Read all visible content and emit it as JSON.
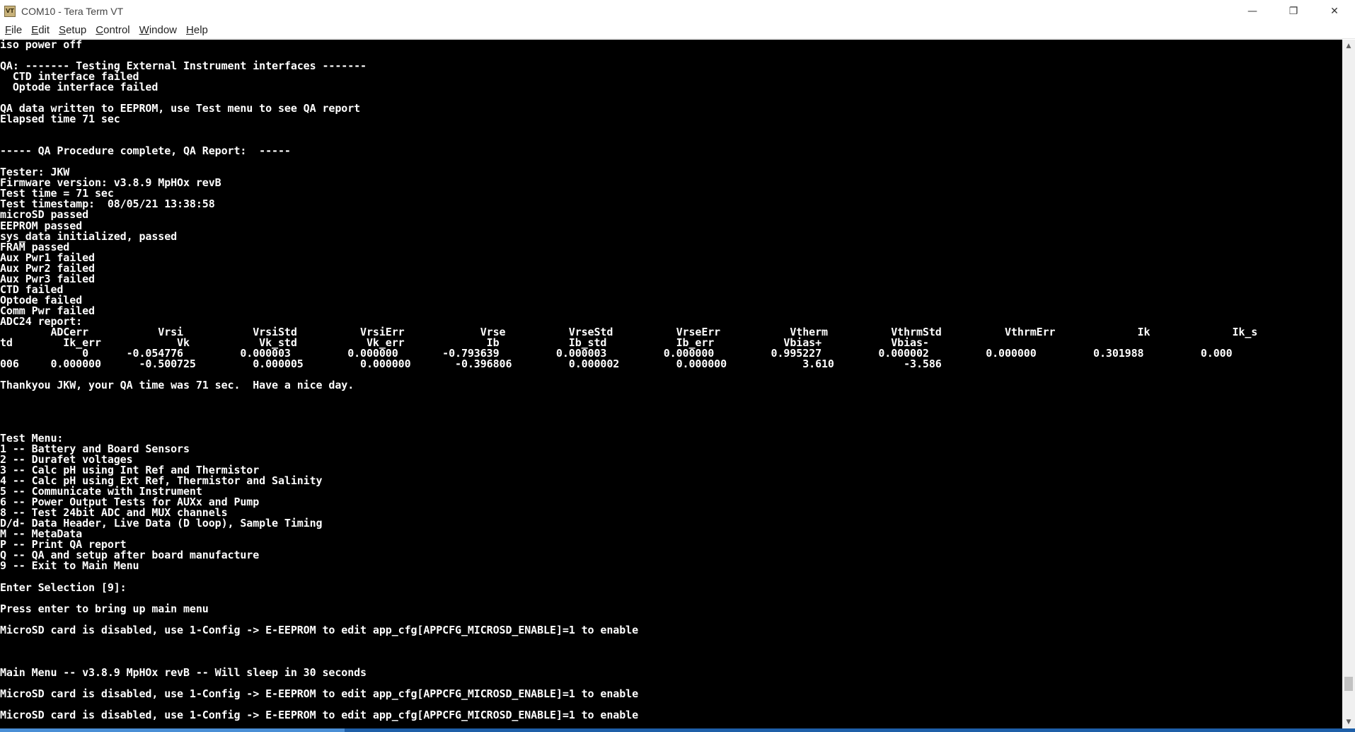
{
  "window": {
    "title": "COM10 - Tera Term VT",
    "icon_label": "VT",
    "controls": {
      "minimize": "—",
      "maximize": "❐",
      "close": "✕"
    }
  },
  "menu": [
    {
      "first": "F",
      "rest": "ile"
    },
    {
      "first": "E",
      "rest": "dit"
    },
    {
      "first": "S",
      "rest": "etup"
    },
    {
      "first": "C",
      "rest": "ontrol"
    },
    {
      "first": "W",
      "rest": "indow"
    },
    {
      "first": "H",
      "rest": "elp"
    }
  ],
  "terminal": {
    "lines": [
      {
        "row": 0,
        "text": "iso power off"
      },
      {
        "row": 2,
        "text": "QA: ------- Testing External Instrument interfaces -------"
      },
      {
        "row": 3,
        "text": "  CTD interface failed"
      },
      {
        "row": 4,
        "text": "  Optode interface failed"
      },
      {
        "row": 6,
        "text": "QA data written to EEPROM, use Test menu to see QA report"
      },
      {
        "row": 7,
        "text": "Elapsed time 71 sec"
      },
      {
        "row": 10,
        "text": "----- QA Procedure complete, QA Report:  -----"
      },
      {
        "row": 12,
        "text": "Tester: JKW"
      },
      {
        "row": 13,
        "text": "Firmware version: v3.8.9 MpHOx revB"
      },
      {
        "row": 14,
        "text": "Test time = 71 sec"
      },
      {
        "row": 15,
        "text": "Test timestamp:  08/05/21 13:38:58"
      },
      {
        "row": 16,
        "text": "microSD passed"
      },
      {
        "row": 17,
        "text": "EEPROM passed"
      },
      {
        "row": 18,
        "text": "sys_data initialized, passed"
      },
      {
        "row": 19,
        "text": "FRAM passed"
      },
      {
        "row": 20,
        "text": "Aux Pwr1 failed"
      },
      {
        "row": 21,
        "text": "Aux Pwr2 failed"
      },
      {
        "row": 22,
        "text": "Aux Pwr3 failed"
      },
      {
        "row": 23,
        "text": "CTD failed"
      },
      {
        "row": 24,
        "text": "Optode failed"
      },
      {
        "row": 25,
        "text": "Comm Pwr failed"
      },
      {
        "row": 26,
        "text": "ADC24 report:"
      },
      {
        "row": 27,
        "text": "        ADCerr           Vrsi           VrsiStd          VrsiErr            Vrse          VrseStd          VrseErr           Vtherm          VthrmStd          VthrmErr             Ik             Ik_s"
      },
      {
        "row": 28,
        "text": "td        Ik_err            Vk           Vk_std           Vk_err             Ib           Ib_std           Ib_err           Vbias+           Vbias-"
      },
      {
        "row": 29,
        "text": "             0      -0.054776         0.000003         0.000000       -0.793639         0.000003         0.000000         0.995227         0.000002         0.000000         0.301988         0.000"
      },
      {
        "row": 30,
        "text": "006     0.000000      -0.500725         0.000005         0.000000       -0.396806         0.000002         0.000000            3.610           -3.586"
      },
      {
        "row": 32,
        "text": "Thankyou JKW, your QA time was 71 sec.  Have a nice day."
      },
      {
        "row": 37,
        "text": "Test Menu:"
      },
      {
        "row": 38,
        "text": "1 -- Battery and Board Sensors"
      },
      {
        "row": 39,
        "text": "2 -- Durafet voltages"
      },
      {
        "row": 40,
        "text": "3 -- Calc pH using Int Ref and Thermistor"
      },
      {
        "row": 41,
        "text": "4 -- Calc pH using Ext Ref, Thermistor and Salinity"
      },
      {
        "row": 42,
        "text": "5 -- Communicate with Instrument"
      },
      {
        "row": 43,
        "text": "6 -- Power Output Tests for AUXx and Pump"
      },
      {
        "row": 44,
        "text": "8 -- Test 24bit ADC and MUX channels"
      },
      {
        "row": 45,
        "text": "D/d- Data Header, Live Data (D loop), Sample Timing"
      },
      {
        "row": 46,
        "text": "M -- MetaData"
      },
      {
        "row": 47,
        "text": "P -- Print QA report"
      },
      {
        "row": 48,
        "text": "Q -- QA and setup after board manufacture"
      },
      {
        "row": 49,
        "text": "9 -- Exit to Main Menu"
      },
      {
        "row": 51,
        "text": "Enter Selection [9]:"
      },
      {
        "row": 53,
        "text": "Press enter to bring up main menu"
      },
      {
        "row": 55,
        "text": "MicroSD card is disabled, use 1-Config -> E-EEPROM to edit app_cfg[APPCFG_MICROSD_ENABLE]=1 to enable"
      },
      {
        "row": 59,
        "text": "Main Menu -- v3.8.9 MpHOx revB -- Will sleep in 30 seconds"
      },
      {
        "row": 61,
        "text": "MicroSD card is disabled, use 1-Config -> E-EEPROM to edit app_cfg[APPCFG_MICROSD_ENABLE]=1 to enable"
      },
      {
        "row": 63,
        "text": "MicroSD card is disabled, use 1-Config -> E-EEPROM to edit app_cfg[APPCFG_MICROSD_ENABLE]=1 to enable"
      }
    ]
  },
  "scrollbar": {
    "up": "▲",
    "down": "▼"
  },
  "colors": {
    "terminal_bg": "#000000",
    "terminal_fg": "#ffffff",
    "taskbar_accent": "#1e5fa8"
  }
}
